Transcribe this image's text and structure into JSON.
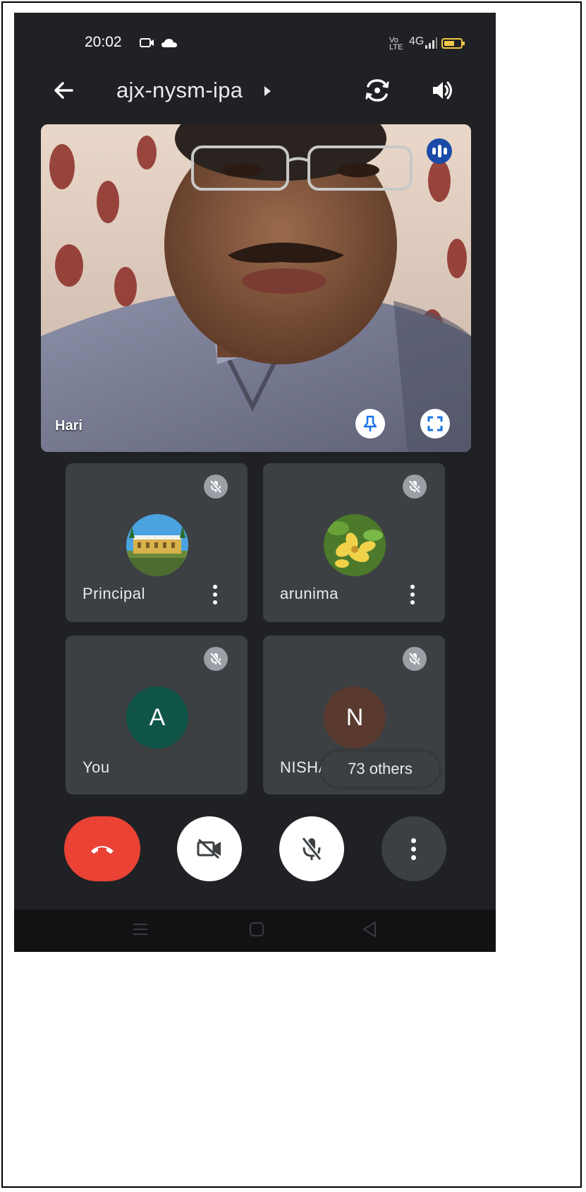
{
  "status_bar": {
    "time": "20:02",
    "network_label": "Vo LTE",
    "signal_label": "4G"
  },
  "header": {
    "meeting_code": "ajx-nysm-ipa"
  },
  "main_speaker": {
    "name": "Hari"
  },
  "tiles": [
    {
      "name": "Principal",
      "avatar": "photo-building"
    },
    {
      "name": "arunima",
      "avatar": "photo-flower"
    },
    {
      "name": "You",
      "initial": "A",
      "avatar_color": "#0f5447"
    },
    {
      "name": "NISHA",
      "initial": "N",
      "avatar_color": "#5a3a2e"
    }
  ],
  "others_badge": "73 others",
  "colors": {
    "background": "#202124",
    "tile": "#3c4043",
    "end_call": "#ea4335",
    "speaking_indicator": "#1a4ba8",
    "battery": "#f2c744"
  },
  "icons": [
    "back-arrow-icon",
    "flip-camera-icon",
    "speaker-icon",
    "audio-level-icon",
    "pin-icon",
    "fullscreen-icon",
    "mic-off-icon",
    "more-vert-icon",
    "end-call-icon",
    "camera-off-icon"
  ]
}
